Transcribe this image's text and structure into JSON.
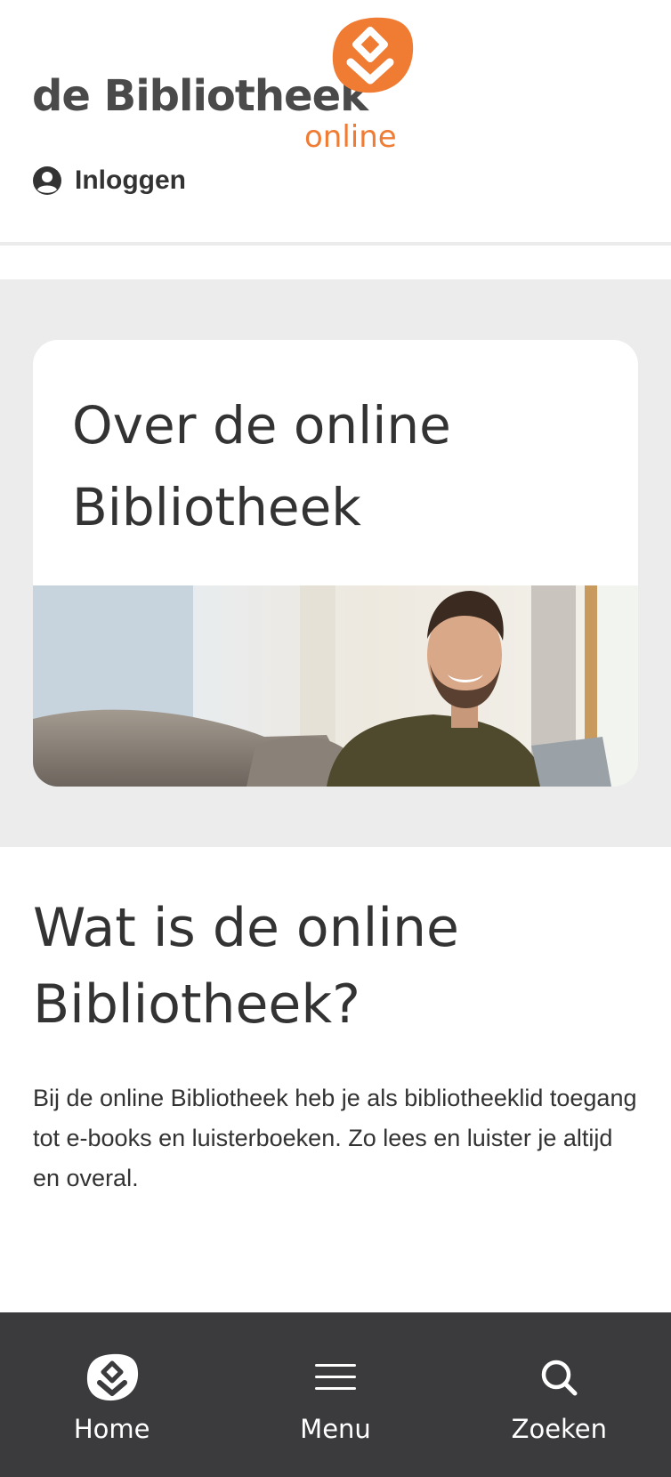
{
  "brand": {
    "name": "de Bibliotheek",
    "sub": "online",
    "accent_color": "#f07c34",
    "text_color": "#4a4a4a"
  },
  "header": {
    "login_label": "Inloggen",
    "login_icon": "user-circle-icon"
  },
  "hero": {
    "title": "Over de online Bibliotheek",
    "image": "smiling-man-on-sofa-photo"
  },
  "intro": {
    "title": "Wat is de online Bibliotheek?",
    "body": "Bij de online Bibliotheek heb je als bibliotheeklid toegang tot e-books en luisterboeken. Zo lees en luister je altijd en overal."
  },
  "bottom_nav": {
    "background": "#3b3a3c",
    "items": [
      {
        "label": "Home",
        "icon": "bibliotheek-home-icon"
      },
      {
        "label": "Menu",
        "icon": "hamburger-menu-icon"
      },
      {
        "label": "Zoeken",
        "icon": "search-icon"
      }
    ]
  }
}
